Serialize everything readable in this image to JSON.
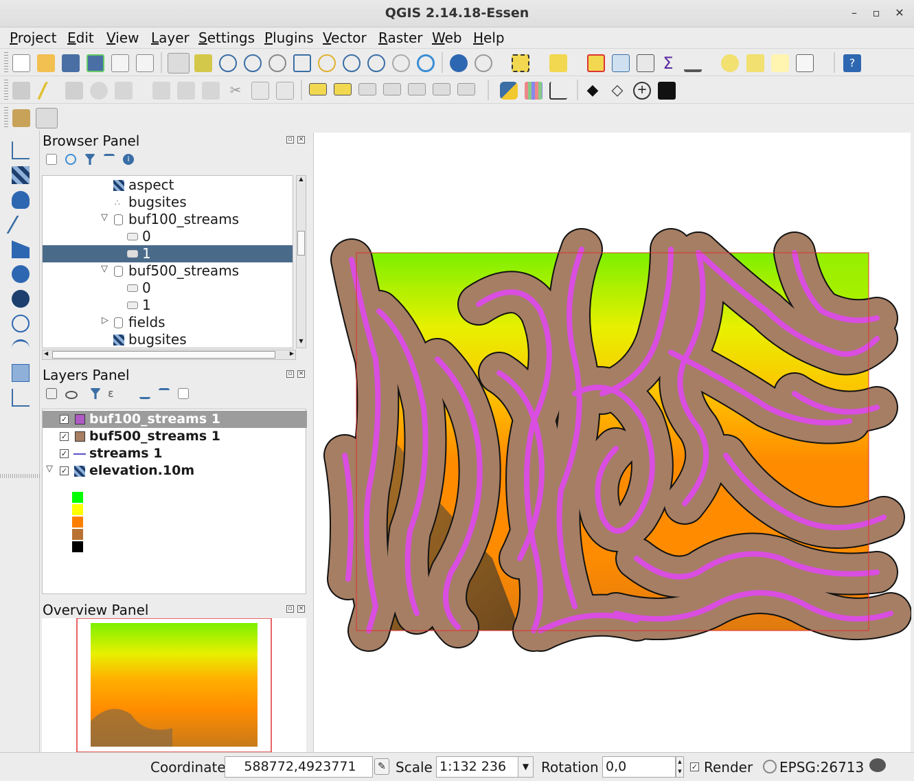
{
  "window": {
    "title": "QGIS 2.14.18-Essen"
  },
  "menu": [
    "Project",
    "Edit",
    "View",
    "Layer",
    "Settings",
    "Plugins",
    "Vector",
    "Raster",
    "Web",
    "Help"
  ],
  "browser_panel": {
    "title": "Browser Panel",
    "items": [
      {
        "label": "aspect",
        "icon": "raster-icon"
      },
      {
        "label": "bugsites",
        "icon": "point-layer-icon"
      },
      {
        "label": "buf100_streams",
        "icon": "database-icon",
        "expanded": true
      },
      {
        "label": "0",
        "icon": "polygon-layer-icon"
      },
      {
        "label": "1",
        "icon": "polygon-layer-icon",
        "selected": true
      },
      {
        "label": "buf500_streams",
        "icon": "database-icon",
        "expanded": true
      },
      {
        "label": "0",
        "icon": "polygon-layer-icon"
      },
      {
        "label": "1",
        "icon": "polygon-layer-icon"
      },
      {
        "label": "fields",
        "icon": "database-icon",
        "expanded": false
      },
      {
        "label": "bugsites",
        "icon": "raster-icon"
      }
    ]
  },
  "layers_panel": {
    "title": "Layers Panel",
    "layers": [
      {
        "name": "buf100_streams 1",
        "checked": true,
        "color": "#b05ac8",
        "selected": true
      },
      {
        "name": "buf500_streams 1",
        "checked": true,
        "color": "#a57e64"
      },
      {
        "name": "streams 1",
        "checked": true,
        "color": "#5a50c8"
      },
      {
        "name": "elevation.10m",
        "checked": true,
        "color": "raster"
      }
    ],
    "legend_colors": [
      "#00ff00",
      "#ffff00",
      "#ff8000",
      "#b87333",
      "#000000"
    ]
  },
  "overview_panel": {
    "title": "Overview Panel"
  },
  "status": {
    "coordinate_label": "Coordinate",
    "coordinate_value": "588772,4923771",
    "scale_label": "Scale",
    "scale_value": "1:132 236",
    "rotation_label": "Rotation",
    "rotation_value": "0,0",
    "render_label": "Render",
    "render_checked": true,
    "crs": "EPSG:26713"
  },
  "colors": {
    "buffer_500": "#a57e64",
    "buffer_100": "#d94ee0",
    "extent": "#e03030"
  }
}
